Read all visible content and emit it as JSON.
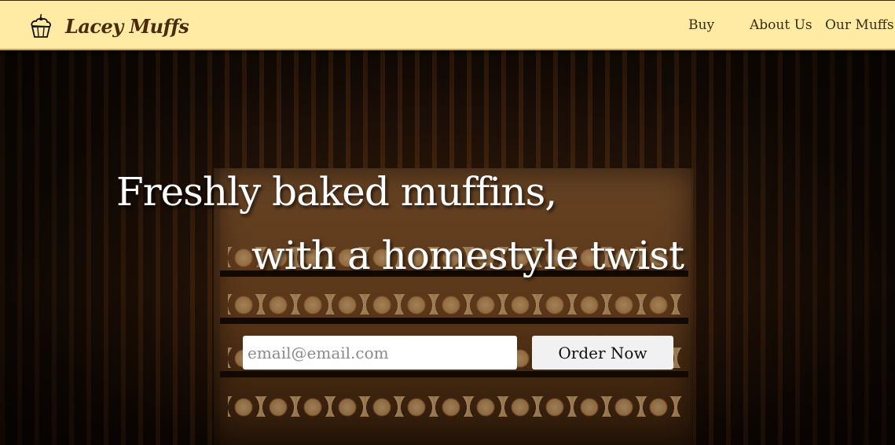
{
  "brand": {
    "name": "Lacey Muffs",
    "logo_icon": "cupcake-icon"
  },
  "nav": {
    "items": [
      {
        "label": "Buy"
      },
      {
        "label": "About Us"
      },
      {
        "label": "Our Muffs"
      }
    ]
  },
  "hero": {
    "headline_line1": "Freshly baked muffins,",
    "headline_line2": "with a homestyle twist",
    "email_placeholder": "email@email.com",
    "email_value": "",
    "cta_label": "Order Now"
  },
  "colors": {
    "navbar_bg": "#FFEBA4",
    "brand_text": "#4A2A08",
    "nav_text": "#3C2A10",
    "headline_text": "#FFFFFF",
    "button_bg": "#F1F1F1"
  }
}
